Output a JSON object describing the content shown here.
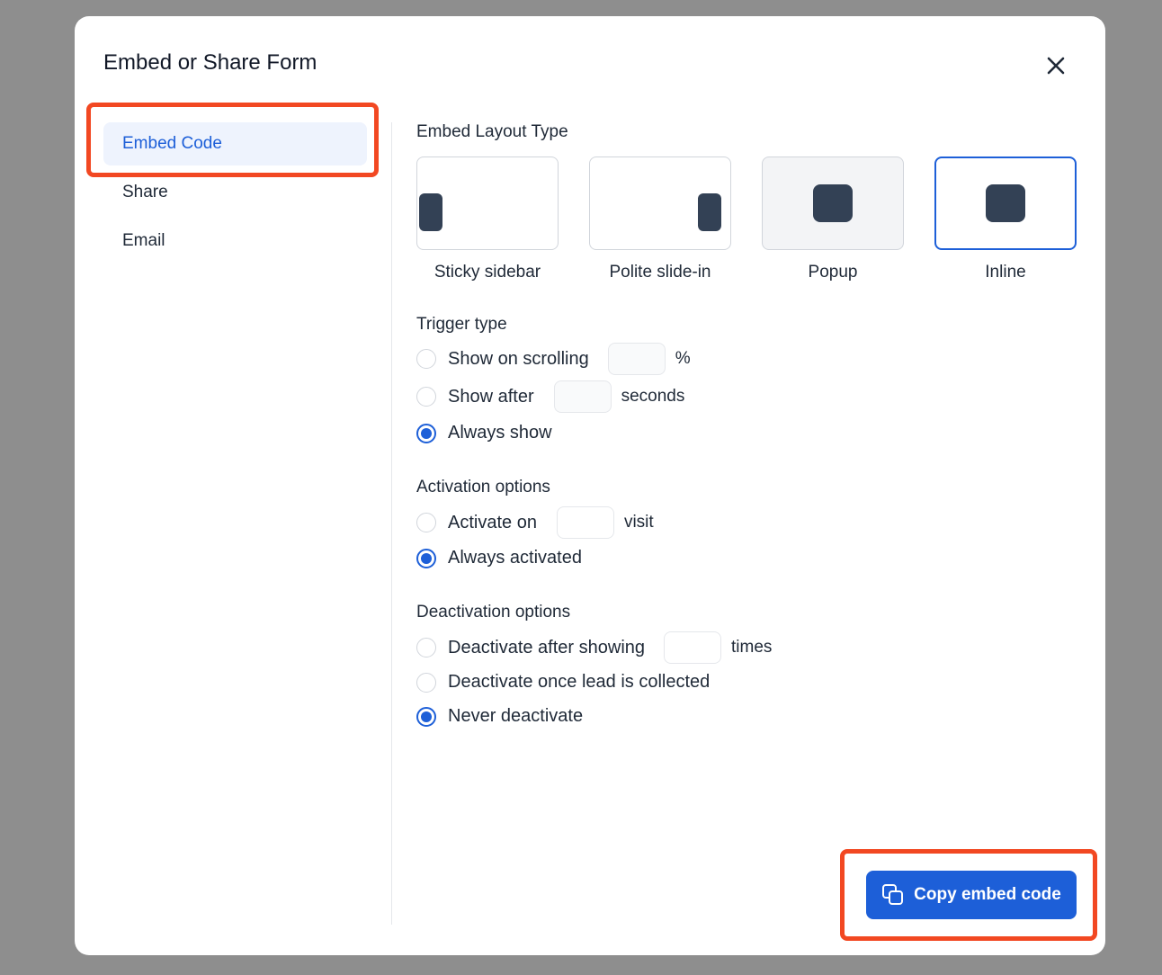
{
  "modal": {
    "title": "Embed or Share Form"
  },
  "sidebar": {
    "items": [
      {
        "label": "Embed Code",
        "active": true
      },
      {
        "label": "Share",
        "active": false
      },
      {
        "label": "Email",
        "active": false
      }
    ]
  },
  "layout": {
    "title": "Embed Layout Type",
    "options": [
      {
        "label": "Sticky sidebar"
      },
      {
        "label": "Polite slide-in"
      },
      {
        "label": "Popup"
      },
      {
        "label": "Inline",
        "selected": true
      }
    ]
  },
  "trigger": {
    "title": "Trigger type",
    "scrolling": {
      "label": "Show on scrolling",
      "value": "",
      "suffix": "%"
    },
    "after": {
      "label": "Show after",
      "value": "",
      "suffix": "seconds"
    },
    "always": {
      "label": "Always show",
      "checked": true
    }
  },
  "activation": {
    "title": "Activation options",
    "activate_on": {
      "label": "Activate on",
      "value": "",
      "suffix": "visit"
    },
    "always": {
      "label": "Always activated",
      "checked": true
    }
  },
  "deactivation": {
    "title": "Deactivation options",
    "after_showing": {
      "label": "Deactivate after showing",
      "value": "",
      "suffix": "times"
    },
    "once_lead": {
      "label": "Deactivate once lead is collected"
    },
    "never": {
      "label": "Never deactivate",
      "checked": true
    }
  },
  "actions": {
    "copy_label": "Copy embed code"
  },
  "colors": {
    "accent": "#1d5fd8",
    "highlight": "#f24822",
    "shape": "#334155"
  },
  "icons": {
    "close": "close-icon",
    "copy": "copy-icon"
  }
}
